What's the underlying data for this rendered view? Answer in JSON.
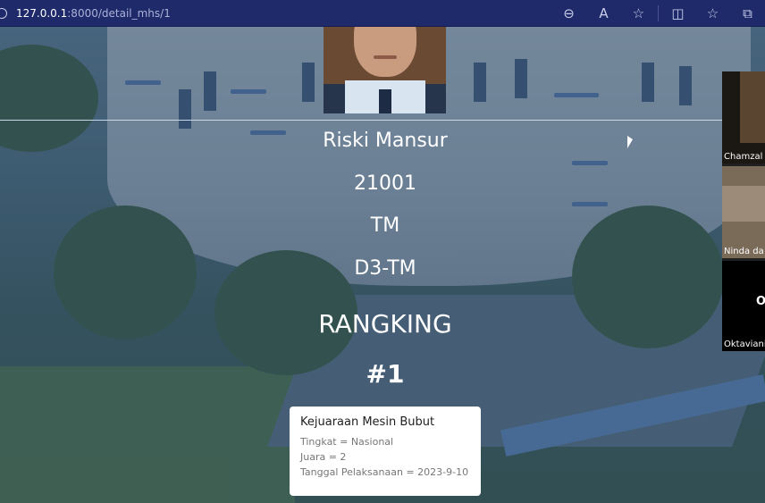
{
  "browser": {
    "url_host": "127.0.0.1",
    "url_rest": ":8000/detail_mhs/1",
    "icons": [
      "zoom-out-icon",
      "read-aloud-icon",
      "favorite-star-icon",
      "split-screen-icon",
      "favorites-icon",
      "collections-icon"
    ],
    "icon_glyphs": [
      "⊖",
      "A",
      "☆",
      "◫",
      "☆",
      "⧉"
    ]
  },
  "student": {
    "name": "Riski Mansur",
    "nim": "21001",
    "prodi": "TM",
    "kelas": "D3-TM"
  },
  "ranking": {
    "label": "RANGKING",
    "value": "#1"
  },
  "achievement": {
    "title": "Kejuaraan Mesin Bubut",
    "tingkat": "Tingkat = Nasional",
    "juara": "Juara = 2",
    "tanggal": "Tanggal Pelaksanaan = 2023-9-10"
  },
  "video_call": {
    "participants": [
      {
        "label": "Chamzal d"
      },
      {
        "label": "Ninda da"
      },
      {
        "label": "Oktaviani",
        "initials": "Ol"
      }
    ]
  }
}
